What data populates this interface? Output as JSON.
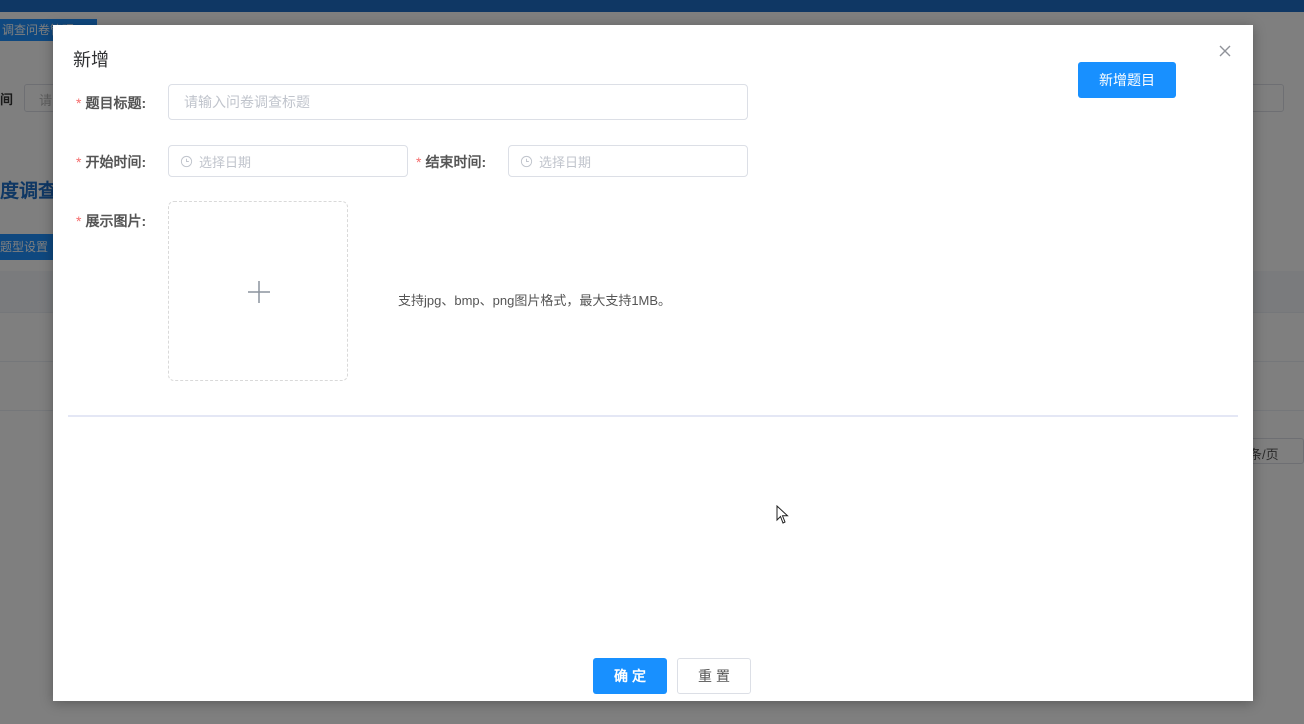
{
  "background": {
    "tab_label": "调查问卷管理",
    "filter_label": "间",
    "filter_placeholder": "请",
    "page_title": "度调查问",
    "action_button": "题型设置",
    "pager_text": "条/页"
  },
  "dialog": {
    "title": "新增",
    "add_question_label": "新增题目",
    "fields": {
      "title_label": "题目标题:",
      "title_placeholder": "请输入问卷调查标题",
      "start_label": "开始时间:",
      "start_placeholder": "选择日期",
      "end_label": "结束时间:",
      "end_placeholder": "选择日期",
      "image_label": "展示图片:",
      "image_hint": "支持jpg、bmp、png图片格式，最大支持1MB。"
    },
    "required_mark": "*",
    "confirm_label": "确定",
    "reset_label": "重置"
  },
  "colors": {
    "primary": "#1890ff",
    "required": "#f56c6c",
    "topbar": "#1e6fc8"
  },
  "icons": {
    "close": "close-icon",
    "clock": "clock-icon",
    "plus": "plus-icon",
    "cursor": "mouse-cursor-icon"
  }
}
